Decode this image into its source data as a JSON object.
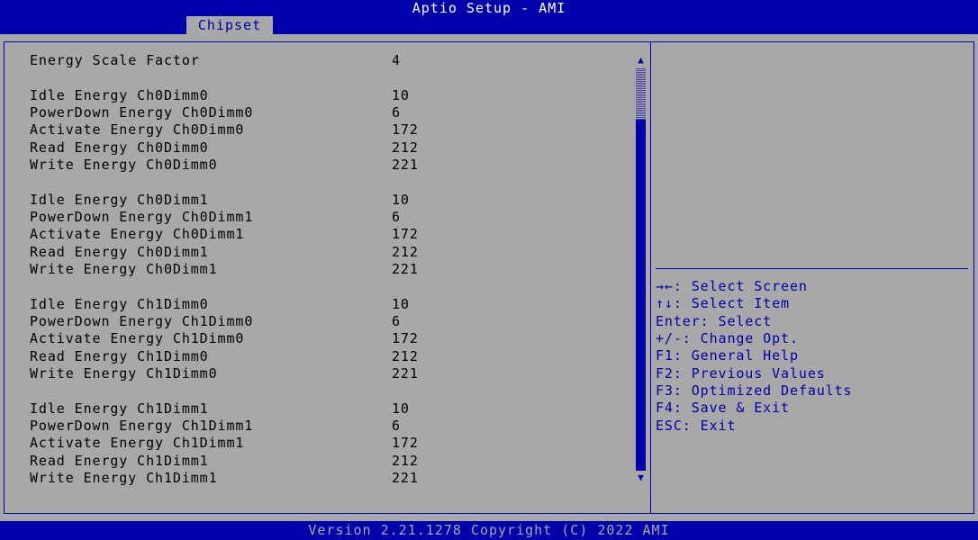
{
  "app": {
    "title": "Aptio Setup - AMI"
  },
  "tabs": [
    {
      "label": "Chipset"
    }
  ],
  "settings": [
    {
      "label": "Energy Scale Factor",
      "value": "4"
    },
    {
      "label": "Idle Energy Ch0Dimm0",
      "value": "10"
    },
    {
      "label": "PowerDown Energy Ch0Dimm0",
      "value": "6"
    },
    {
      "label": "Activate Energy Ch0Dimm0",
      "value": "172"
    },
    {
      "label": "Read Energy Ch0Dimm0",
      "value": "212"
    },
    {
      "label": "Write Energy Ch0Dimm0",
      "value": "221"
    },
    {
      "label": "Idle Energy Ch0Dimm1",
      "value": "10"
    },
    {
      "label": "PowerDown Energy Ch0Dimm1",
      "value": "6"
    },
    {
      "label": "Activate Energy Ch0Dimm1",
      "value": "172"
    },
    {
      "label": "Read Energy Ch0Dimm1",
      "value": "212"
    },
    {
      "label": "Write Energy Ch0Dimm1",
      "value": "221"
    },
    {
      "label": "Idle Energy Ch1Dimm0",
      "value": "10"
    },
    {
      "label": "PowerDown Energy Ch1Dimm0",
      "value": "6"
    },
    {
      "label": "Activate Energy Ch1Dimm0",
      "value": "172"
    },
    {
      "label": "Read Energy Ch1Dimm0",
      "value": "212"
    },
    {
      "label": "Write Energy Ch1Dimm0",
      "value": "221"
    },
    {
      "label": "Idle Energy Ch1Dimm1",
      "value": "10"
    },
    {
      "label": "PowerDown Energy Ch1Dimm1",
      "value": "6"
    },
    {
      "label": "Activate Energy Ch1Dimm1",
      "value": "172"
    },
    {
      "label": "Read Energy Ch1Dimm1",
      "value": "212"
    },
    {
      "label": "Write Energy Ch1Dimm1",
      "value": "221"
    }
  ],
  "help": [
    "→←: Select Screen",
    "↑↓: Select Item",
    "Enter: Select",
    "+/-: Change Opt.",
    "F1: General Help",
    "F2: Previous Values",
    "F3: Optimized Defaults",
    "F4: Save & Exit",
    "ESC: Exit"
  ],
  "scrollbar": {
    "up_glyph": "▲",
    "down_glyph": "▼"
  },
  "footer": {
    "text": "Version 2.21.1278 Copyright (C) 2022 AMI"
  },
  "colors": {
    "background": "#a8a8a8",
    "accent": "#0000aa",
    "text": "#000000",
    "title_text": "#ffffff"
  }
}
